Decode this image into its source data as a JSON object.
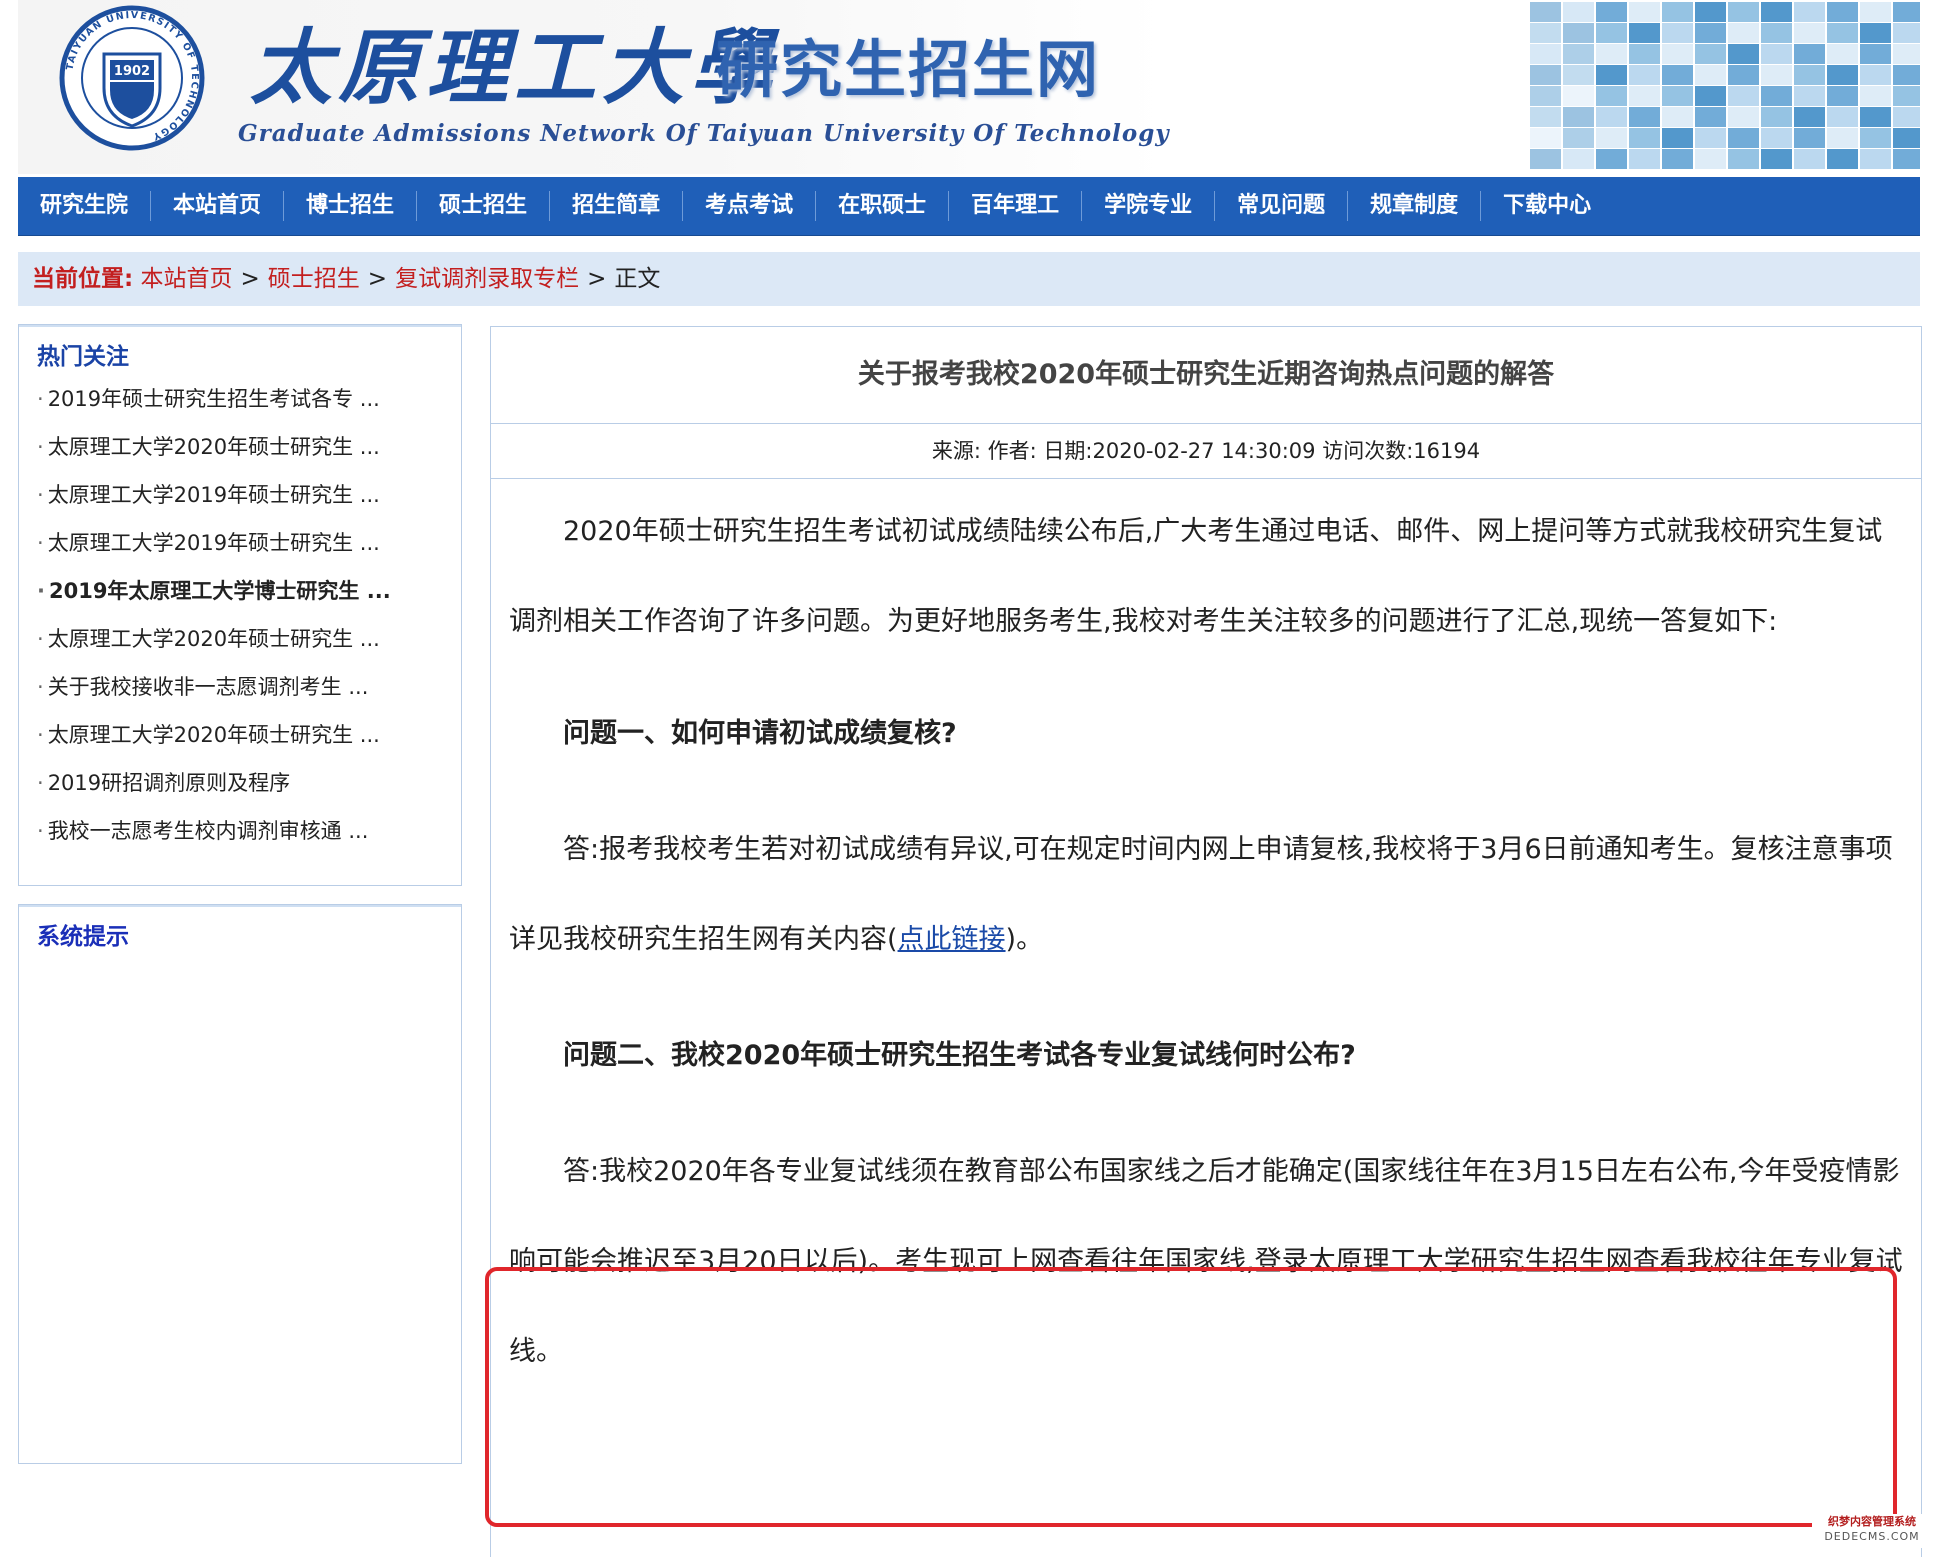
{
  "header": {
    "logo_year": "1902",
    "logo_ring_text": "TAIYUAN UNIVERSITY OF TECHNOLOGY",
    "cn_logo": "太原理工大學",
    "title": "研究生招生网",
    "subtitle": "Graduate Admissions Network Of Taiyuan University Of Technology"
  },
  "nav": {
    "items": [
      "研究生院",
      "本站首页",
      "博士招生",
      "硕士招生",
      "招生简章",
      "考点考试",
      "在职硕士",
      "百年理工",
      "学院专业",
      "常见问题",
      "规章制度",
      "下载中心"
    ]
  },
  "breadcrumb": {
    "label": "当前位置:",
    "items": [
      "本站首页",
      "硕士招生",
      "复试调剂录取专栏"
    ],
    "separator": ">",
    "current": "正文"
  },
  "sidebar": {
    "hot_title": "热门关注",
    "hot_items": [
      "2019年硕士研究生招生考试各专 ...",
      "太原理工大学2020年硕士研究生 ...",
      "太原理工大学2019年硕士研究生 ...",
      "太原理工大学2019年硕士研究生 ...",
      "2019年太原理工大学博士研究生 ...",
      "太原理工大学2020年硕士研究生 ...",
      "关于我校接收非一志愿调剂考生 ...",
      "太原理工大学2020年硕士研究生 ...",
      "2019研招调剂原则及程序",
      "我校一志愿考生校内调剂审核通 ..."
    ],
    "system_title": "系统提示"
  },
  "article": {
    "title": "关于报考我校2020年硕士研究生近期咨询热点问题的解答",
    "meta": "来源:  作者:  日期:2020-02-27 14:30:09 访问次数:16194",
    "intro": "2020年硕士研究生招生考试初试成绩陆续公布后,广大考生通过电话、邮件、网上提问等方式就我校研究生复试调剂相关工作咨询了许多问题。为更好地服务考生,我校对考生关注较多的问题进行了汇总,现统一答复如下:",
    "q1": "问题一、如何申请初试成绩复核?",
    "a1_before": "答:报考我校考生若对初试成绩有异议,可在规定时间内网上申请复核,我校将于3月6日前通知考生。复核注意事项详见我校研究生招生网有关内容(",
    "a1_link": "点此链接",
    "a1_after": ")。",
    "q2": "问题二、我校2020年硕士研究生招生考试各专业复试线何时公布?",
    "a2": "答:我校2020年各专业复试线须在教育部公布国家线之后才能确定(国家线往年在3月15日左右公布,今年受疫情影响可能会推迟至3月20日以后)。考生现可上网查看往年国家线,登录太原理工大学研究生招生网查看我校往年专业复试线。"
  },
  "watermark": {
    "cn": "织梦内容管理系统",
    "en": "DEDECMS.COM"
  },
  "colors": {
    "nav_bg": "#1f5fb8",
    "crumb_bg": "#dce8f6",
    "crumb_red": "#c31f1f",
    "highlight": "#e0262b",
    "link": "#1a4aa8"
  }
}
